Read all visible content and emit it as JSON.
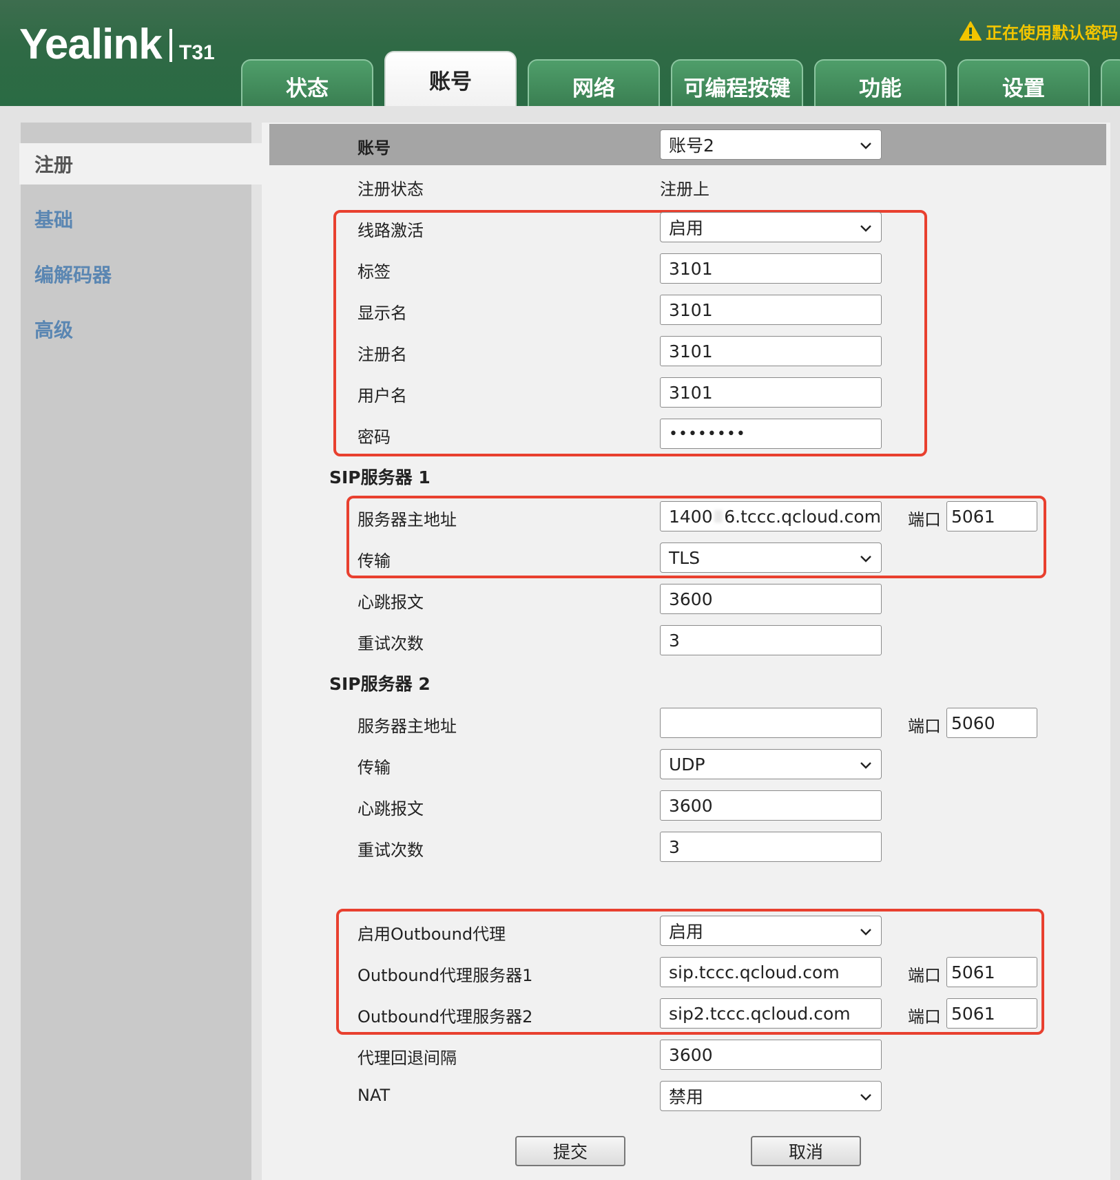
{
  "header": {
    "logo_text": "Yealink",
    "model": "T31",
    "warning": "正在使用默认密码",
    "tabs": [
      "状态",
      "账号",
      "网络",
      "可编程按键",
      "功能",
      "设置"
    ],
    "active_tab": "账号"
  },
  "sidebar": {
    "items": [
      "注册",
      "基础",
      "编解码器",
      "高级"
    ],
    "active": "注册"
  },
  "account": {
    "label": "账号",
    "value": "账号2"
  },
  "reg_status": {
    "label": "注册状态",
    "value": "注册上"
  },
  "line": {
    "active_label": "线路激活",
    "active_value": "启用",
    "tag_label": "标签",
    "tag_value": "3101",
    "display_label": "显示名",
    "display_value": "3101",
    "reg_name_label": "注册名",
    "reg_name_value": "3101",
    "username_label": "用户名",
    "username_value": "3101",
    "password_label": "密码",
    "password_value": "••••••••"
  },
  "sip1": {
    "title": "SIP服务器 1",
    "host_label": "服务器主地址",
    "host_prefix": "1400",
    "host_suffix": "6.tccc.qcloud.com",
    "port_label": "端口",
    "port_value": "5061",
    "transport_label": "传输",
    "transport_value": "TLS",
    "keepalive_label": "心跳报文",
    "keepalive_value": "3600",
    "retry_label": "重试次数",
    "retry_value": "3"
  },
  "sip2": {
    "title": "SIP服务器 2",
    "host_label": "服务器主地址",
    "host_value": "",
    "port_label": "端口",
    "port_value": "5060",
    "transport_label": "传输",
    "transport_value": "UDP",
    "keepalive_label": "心跳报文",
    "keepalive_value": "3600",
    "retry_label": "重试次数",
    "retry_value": "3"
  },
  "outbound": {
    "enable_label": "启用Outbound代理",
    "enable_value": "启用",
    "server1_label": "Outbound代理服务器1",
    "server1_value": "sip.tccc.qcloud.com",
    "server1_port_label": "端口",
    "server1_port": "5061",
    "server2_label": "Outbound代理服务器2",
    "server2_value": "sip2.tccc.qcloud.com",
    "server2_port_label": "端口",
    "server2_port": "5061",
    "fallback_label": "代理回退间隔",
    "fallback_value": "3600",
    "nat_label": "NAT",
    "nat_value": "禁用"
  },
  "buttons": {
    "submit": "提交",
    "cancel": "取消"
  },
  "colors": {
    "header_green": "#2f6a45",
    "tab_green": "#3a7f52",
    "highlight_red": "#e8402f",
    "sidebar_link": "#5a86b2",
    "warning_yellow": "#f2c500"
  }
}
